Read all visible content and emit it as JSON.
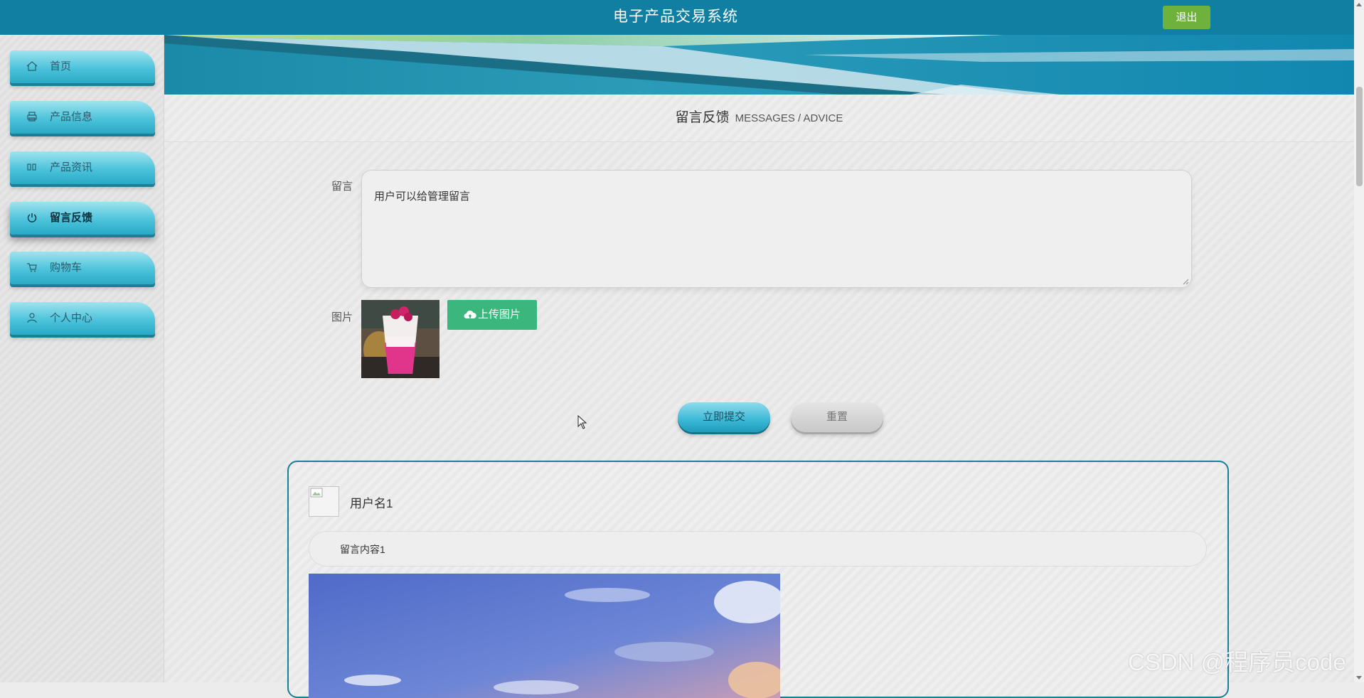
{
  "header": {
    "title": "电子产品交易系统",
    "logout_label": "退出"
  },
  "sidebar": {
    "items": [
      {
        "label": "首页",
        "icon": "home-icon",
        "active": false
      },
      {
        "label": "产品信息",
        "icon": "printer-icon",
        "active": false
      },
      {
        "label": "产品资讯",
        "icon": "columns-icon",
        "active": false
      },
      {
        "label": "留言反馈",
        "icon": "power-icon",
        "active": true
      },
      {
        "label": "购物车",
        "icon": "cart-icon",
        "active": false
      },
      {
        "label": "个人中心",
        "icon": "user-icon",
        "active": false
      }
    ]
  },
  "section": {
    "title_cn": "留言反馈",
    "title_en": "MESSAGES / ADVICE"
  },
  "form": {
    "message_label": "留言",
    "message_value": "用户可以给管理留言",
    "image_label": "图片",
    "upload_label": "上传图片",
    "submit_label": "立即提交",
    "reset_label": "重置"
  },
  "messages": [
    {
      "username": "用户名1",
      "content": "留言内容1"
    }
  ],
  "watermark": "CSDN @程序员code",
  "colors": {
    "topbar": "#117fa2",
    "logout": "#6eb13c",
    "upload": "#3bb77e",
    "accent": "#3bb8d6"
  }
}
